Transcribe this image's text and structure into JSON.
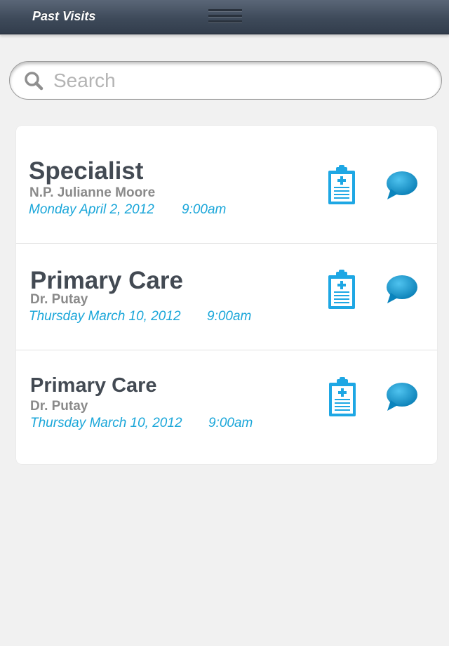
{
  "header": {
    "title": "Past Visits",
    "menu_icon": "hamburger-menu-icon"
  },
  "search": {
    "placeholder": "Search",
    "value": "",
    "icon": "search-icon"
  },
  "visits": [
    {
      "type": "Specialist",
      "provider": "N.P. Julianne Moore",
      "date": "Monday April 2, 2012",
      "time": "9:00am",
      "actions": [
        "clipboard-icon",
        "chat-bubble-icon"
      ]
    },
    {
      "type": "Primary Care",
      "provider": "Dr. Putay",
      "date": "Thursday March 10, 2012",
      "time": "9:00am",
      "actions": [
        "clipboard-icon",
        "chat-bubble-icon"
      ]
    },
    {
      "type": "Primary Care",
      "provider": "Dr. Putay",
      "date": "Thursday March 10, 2012",
      "time": "9:00am",
      "actions": [
        "clipboard-icon",
        "chat-bubble-icon"
      ]
    }
  ],
  "colors": {
    "navbar": "#3e4a5a",
    "accent": "#1aa6d9",
    "title_text": "#434a53",
    "provider_text": "#8a8a8a",
    "icon_blue": "#1ea7e4"
  }
}
